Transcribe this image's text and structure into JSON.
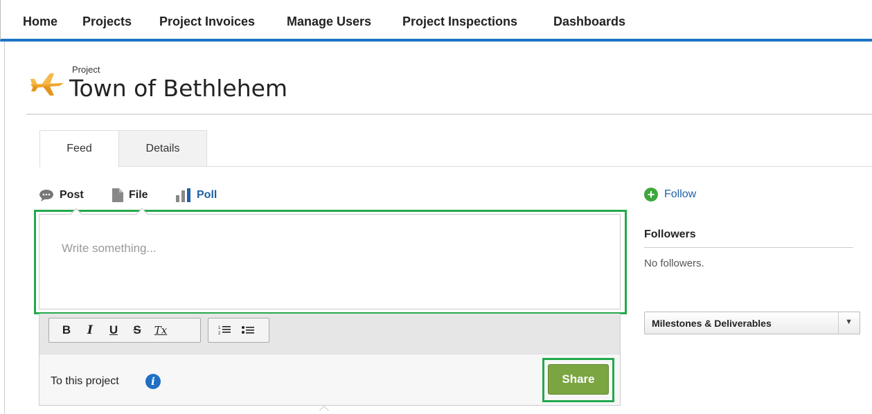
{
  "nav": {
    "items": [
      "Home",
      "Projects",
      "Project Invoices",
      "Manage Users",
      "Project Inspections",
      "Dashboards"
    ]
  },
  "page": {
    "object_label": "Project",
    "title": "Town of Bethlehem",
    "icon": "airplane-icon"
  },
  "tabs": [
    {
      "label": "Feed",
      "active": true
    },
    {
      "label": "Details",
      "active": false
    }
  ],
  "publisher": {
    "actions": [
      {
        "label": "Post",
        "icon": "speech-bubble-icon"
      },
      {
        "label": "File",
        "icon": "file-icon"
      },
      {
        "label": "Poll",
        "icon": "poll-chart-icon"
      }
    ],
    "placeholder": "Write something...",
    "toolbar": {
      "format": [
        "B",
        "I",
        "U",
        "S",
        "Tx"
      ],
      "lists": [
        "numbered-list-icon",
        "bulleted-list-icon"
      ]
    },
    "audience_label": "To this project",
    "share_label": "Share"
  },
  "sidebar": {
    "follow_label": "Follow",
    "followers_heading": "Followers",
    "followers_empty": "No followers.",
    "related_select": "Milestones & Deliverables"
  },
  "colors": {
    "nav_underline": "#1b74c4",
    "highlight": "#22a94b",
    "share_button": "#7ba541",
    "link": "#1f5fa5"
  }
}
